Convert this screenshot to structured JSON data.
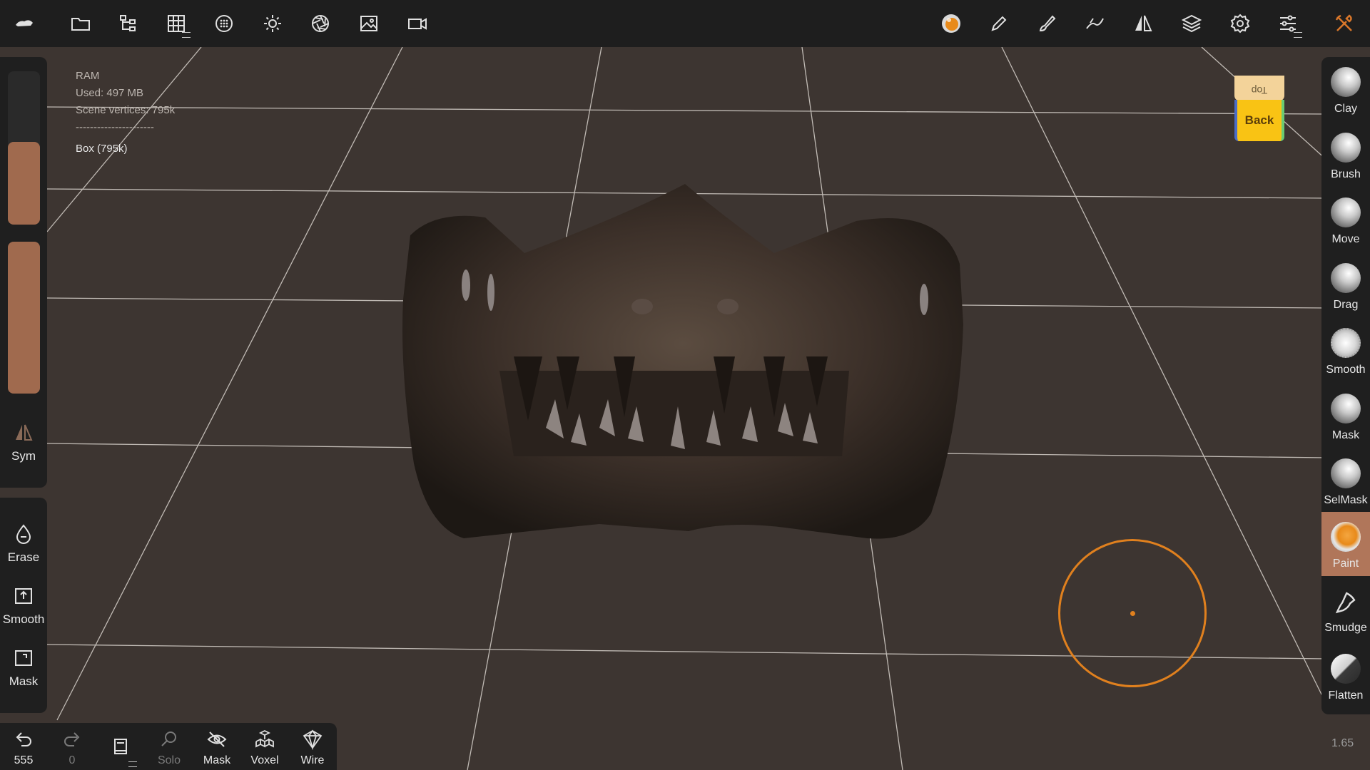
{
  "app": {
    "title": "Nomad Sculpt"
  },
  "top_toolbar": {
    "left_icons": [
      "logo-icon",
      "folder-icon",
      "scene-tree-icon",
      "grid-icon",
      "material-icon",
      "light-icon",
      "aperture-icon",
      "image-icon",
      "camera-icon"
    ],
    "right_icons": [
      "paint-ball-icon",
      "pen-icon",
      "brush-icon",
      "stroke-icon",
      "symmetry-icon",
      "layers-icon",
      "settings-icon",
      "sliders-icon",
      "tools-icon"
    ]
  },
  "stats": {
    "ram_label": "RAM",
    "used": "Used: 497 MB",
    "vertices": "Scene vertices: 795k",
    "separator": "----------------------",
    "object": "Box (795k)"
  },
  "left_panel": {
    "slider_top_level": 0.54,
    "slider_bottom_level": 1.0,
    "sym_label": "Sym",
    "tools": [
      {
        "label": "Erase",
        "icon": "drop-icon"
      },
      {
        "label": "Smooth",
        "icon": "smooth-box-icon"
      },
      {
        "label": "Mask",
        "icon": "mask-box-icon"
      }
    ]
  },
  "bottom_bar": {
    "undo_count": "555",
    "redo_count": "0",
    "solo": "Solo",
    "mask": "Mask",
    "voxel": "Voxel",
    "wire": "Wire"
  },
  "brushes": [
    {
      "label": "Clay",
      "active": false
    },
    {
      "label": "Brush",
      "active": false
    },
    {
      "label": "Move",
      "active": false
    },
    {
      "label": "Drag",
      "active": false
    },
    {
      "label": "Smooth",
      "active": false
    },
    {
      "label": "Mask",
      "active": false
    },
    {
      "label": "SelMask",
      "active": false
    },
    {
      "label": "Paint",
      "active": true
    },
    {
      "label": "Smudge",
      "active": false
    },
    {
      "label": "Flatten",
      "active": false
    }
  ],
  "view_cube": {
    "top": "Top",
    "front": "Back"
  },
  "zoom_value": "1.65",
  "colors": {
    "accent": "#e0801e",
    "panel": "#1f1f1f",
    "active_brush": "#b0765a",
    "viewport": "#3d3531"
  }
}
